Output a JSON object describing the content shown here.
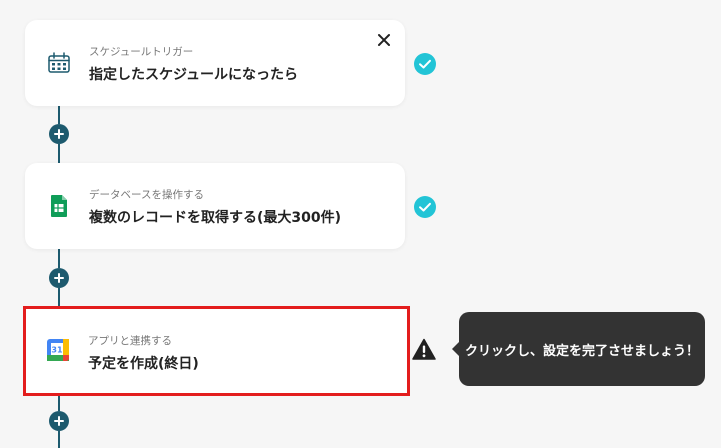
{
  "colors": {
    "background": "#f6f6f6",
    "connector": "#1d5a6e",
    "check": "#22c4d6",
    "highlight_border": "#e31d1d",
    "tooltip_bg": "#333333"
  },
  "steps": [
    {
      "icon": "calendar-schedule-icon",
      "category": "スケジュールトリガー",
      "title": "指定したスケジュールになったら",
      "status": "completed"
    },
    {
      "icon": "google-sheets-icon",
      "category": "データベースを操作する",
      "title": "複数のレコードを取得する(最大300件)",
      "status": "completed"
    },
    {
      "icon": "google-calendar-icon",
      "category": "アプリと連携する",
      "title": "予定を作成(終日)",
      "status": "warning",
      "calendar_icon_number": "31"
    }
  ],
  "tooltip": {
    "text": "クリックし、設定を完了させましょう！"
  }
}
